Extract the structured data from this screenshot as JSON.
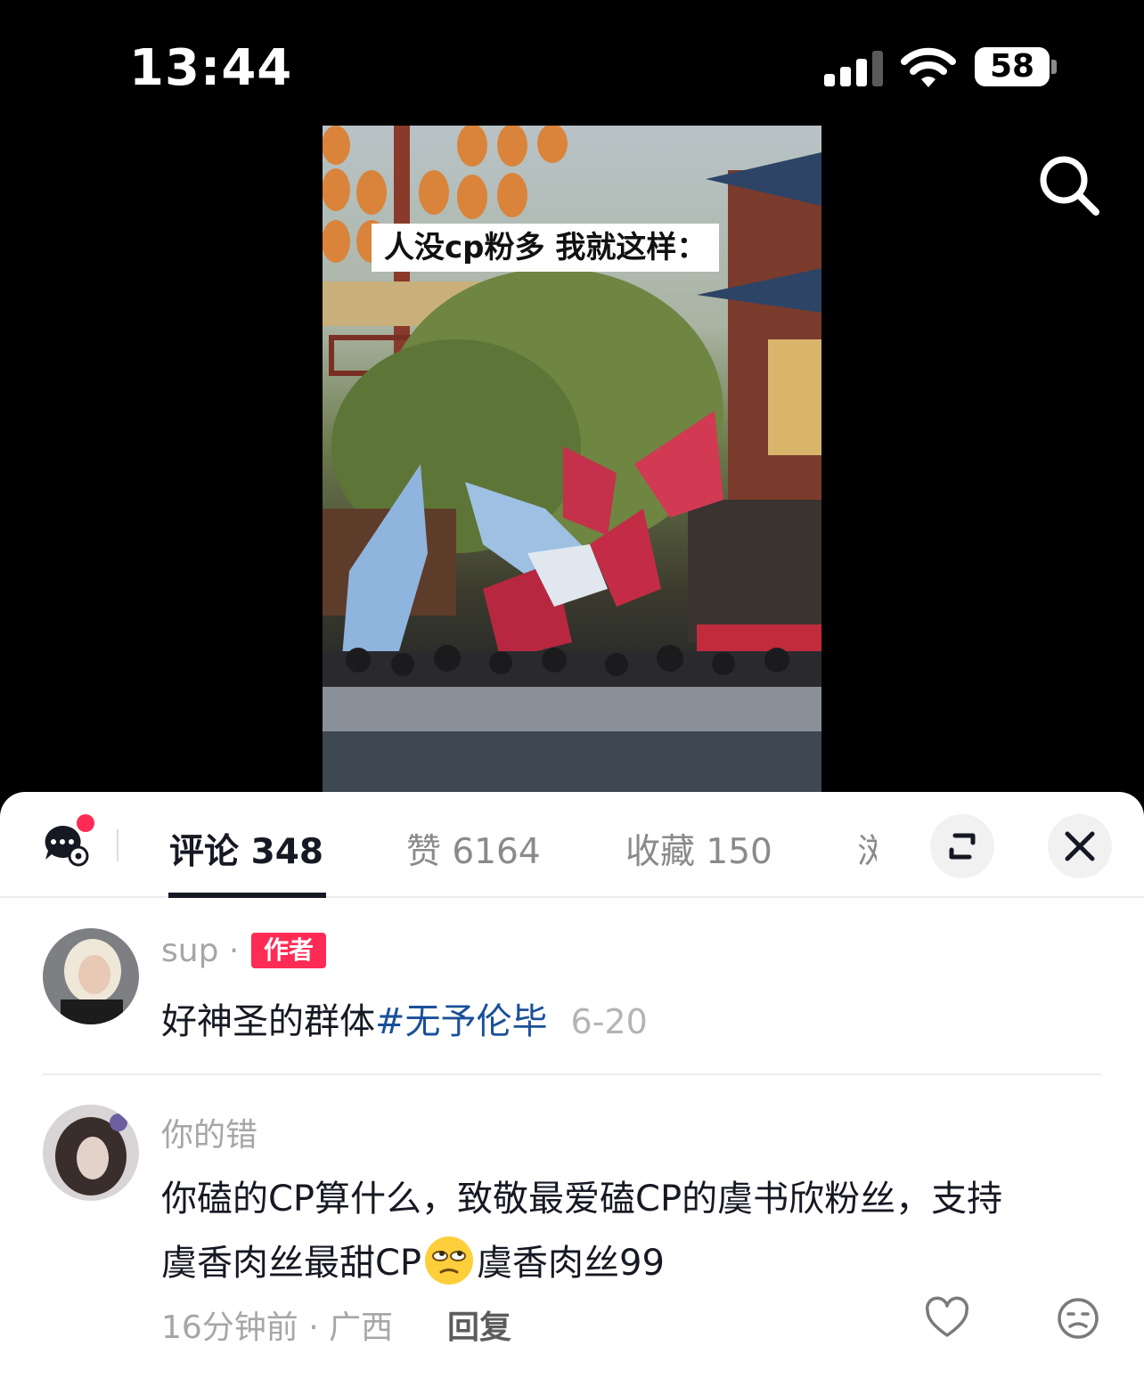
{
  "status_bar": {
    "time": "13:44",
    "battery": "58"
  },
  "video": {
    "caption": "人没cp粉多 我就这样："
  },
  "tabs": [
    {
      "label": "评论 348"
    },
    {
      "label": "赞 6164"
    },
    {
      "label": "收藏 150"
    },
    {
      "label": "浏"
    }
  ],
  "comments": [
    {
      "username": "sup ·",
      "badge": "作者",
      "text": "好神圣的群体",
      "hashtag": "#无予伦毕",
      "date": "6-20"
    },
    {
      "username": "你的错",
      "text_line1": "你磕的CP算什么，致敬最爱磕CP的虞书欣粉丝，支持",
      "text_line2_a": "虞香肉丝最甜CP",
      "emoji": "eye-roll-emoji",
      "text_line2_b": "虞香肉丝99",
      "time_location": "16分钟前 · 广西",
      "reply_label": "回复"
    }
  ],
  "colors": {
    "accent": "#fe2c55",
    "hashtag": "#1a5099"
  }
}
